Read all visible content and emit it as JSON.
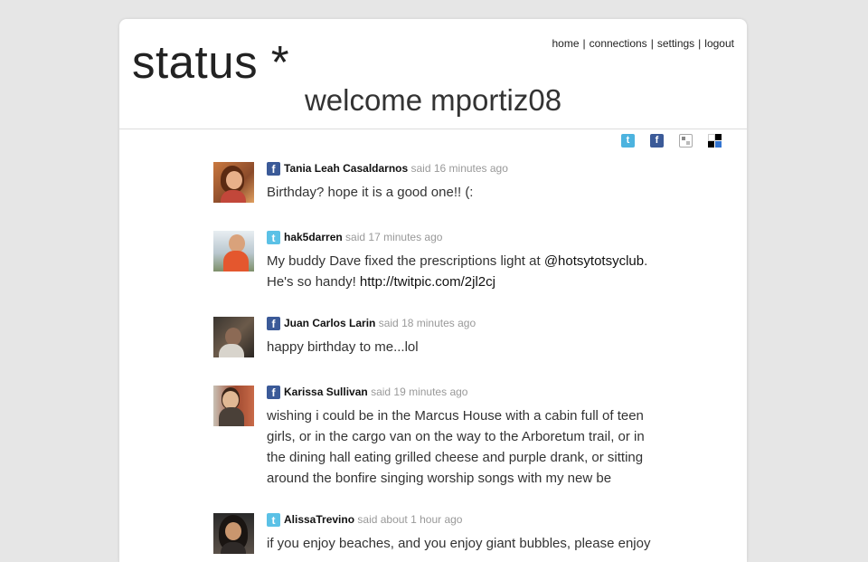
{
  "app": {
    "logo": "status *",
    "welcome_word": "welcome",
    "username": "mportiz08"
  },
  "nav": {
    "home": "home",
    "connections": "connections",
    "settings": "settings",
    "logout": "logout",
    "separator": "|"
  },
  "share_icons": [
    "twitter-icon",
    "facebook-icon",
    "google-bookmarks-icon",
    "delicious-icon"
  ],
  "colors": {
    "facebook": "#3b5a98",
    "twitter": "#5bc1e6",
    "muted": "#999999"
  },
  "posts": [
    {
      "service": "facebook",
      "author": "Tania Leah Casaldarnos",
      "ago": "said 16 minutes ago",
      "text": "Birthday? hope it is a good one!! (:"
    },
    {
      "service": "twitter",
      "author": "hak5darren",
      "ago": "said 17 minutes ago",
      "text_before": "My buddy Dave fixed the prescriptions light at ",
      "mention": "@hotsytotsyclub",
      "text_middle": ". He's so handy! ",
      "link": "http://twitpic.com/2jl2cj"
    },
    {
      "service": "facebook",
      "author": "Juan Carlos Larin",
      "ago": "said 18 minutes ago",
      "text": "happy birthday to me...lol"
    },
    {
      "service": "facebook",
      "author": "Karissa Sullivan",
      "ago": "said 19 minutes ago",
      "text": "wishing i could be in the Marcus House with a cabin full of teen girls, or in the cargo van on the way to the Arboretum trail, or in the dining hall eating grilled cheese and purple drank, or sitting around the bonfire singing worship songs with my new be"
    },
    {
      "service": "twitter",
      "author": "AlissaTrevino",
      "ago": "said about 1 hour ago",
      "text": "if you enjoy beaches, and you enjoy giant bubbles, please enjoy"
    }
  ]
}
